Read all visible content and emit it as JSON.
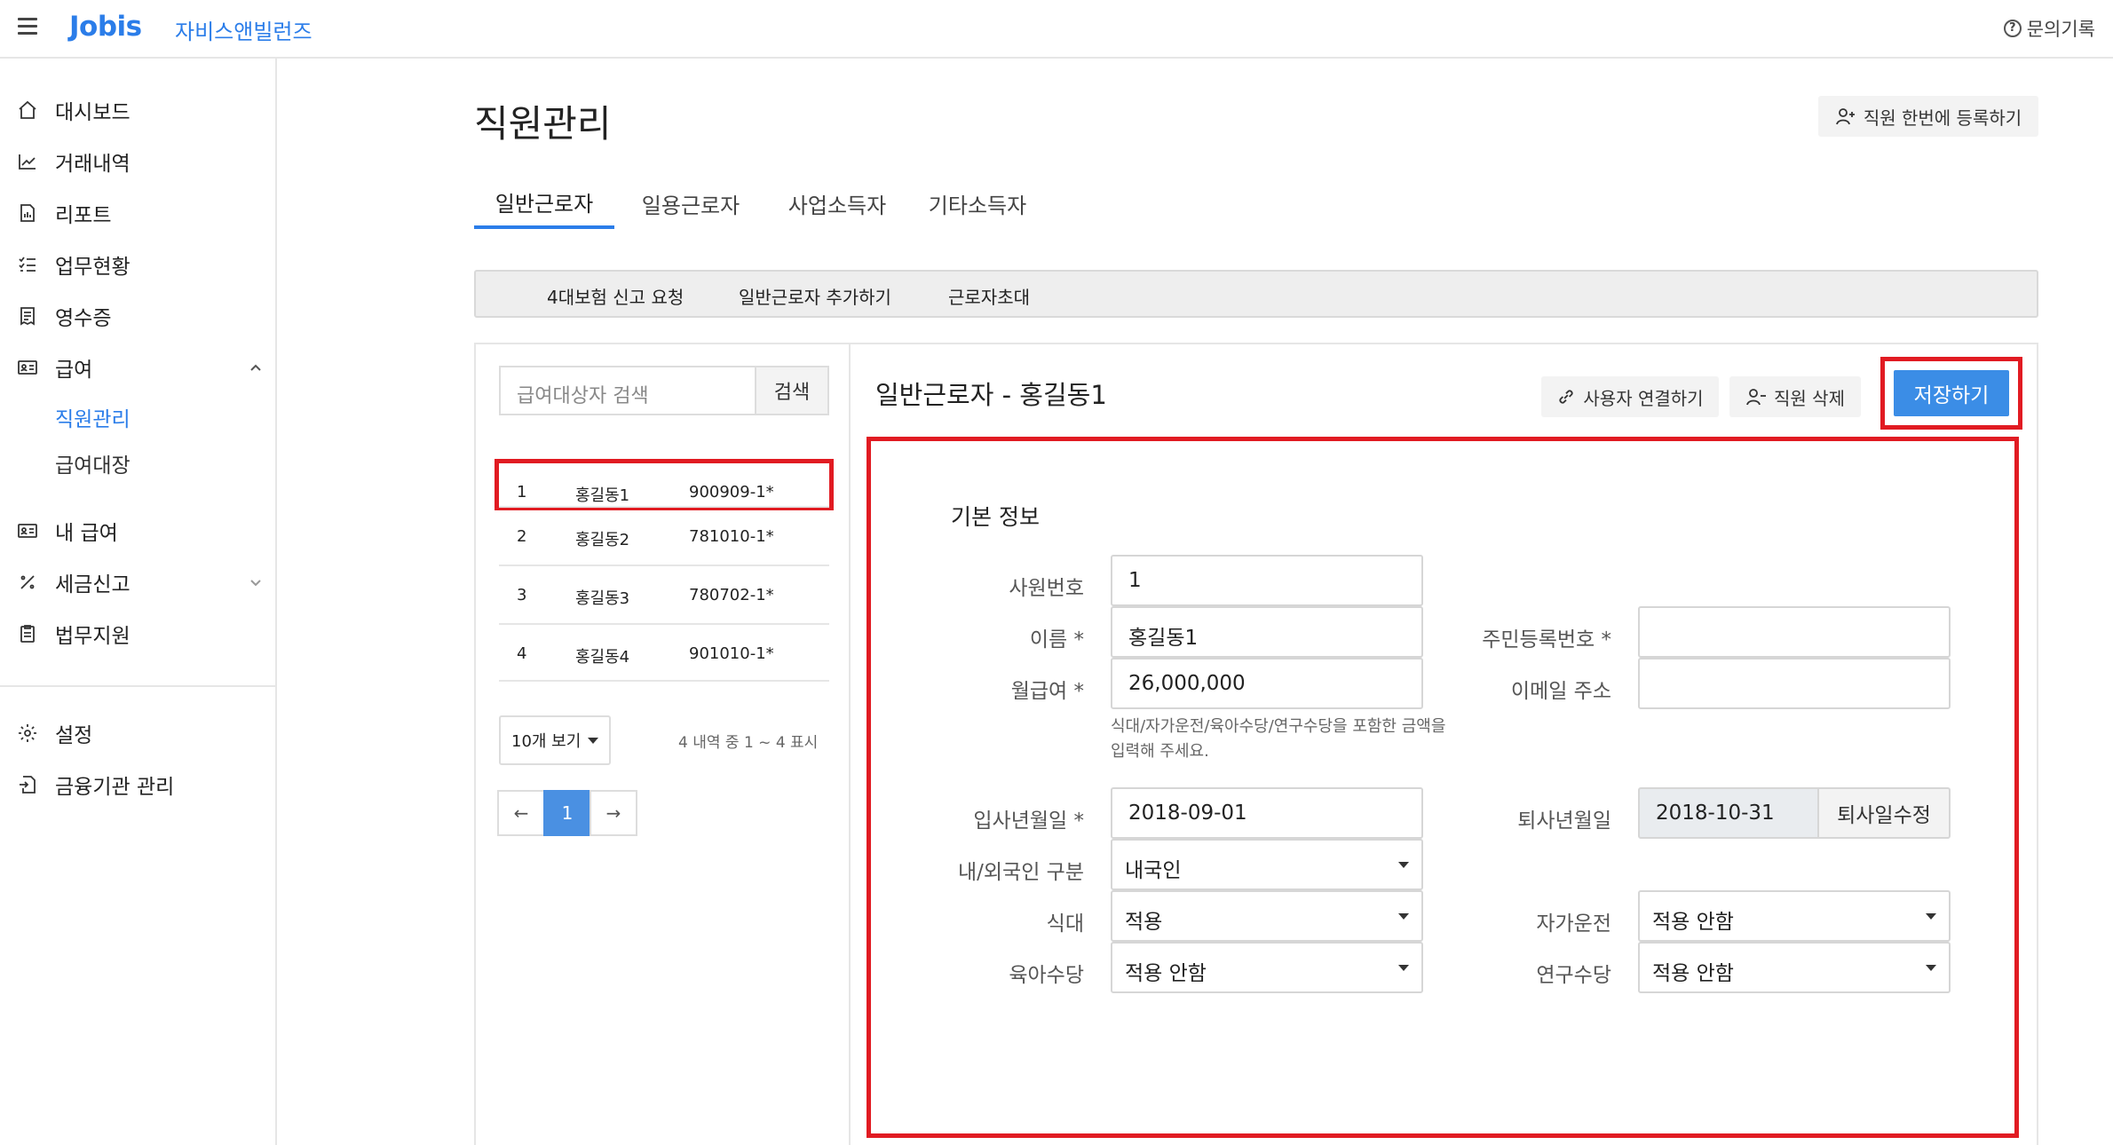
{
  "header": {
    "logo": "Jobis",
    "company": "자비스앤빌런즈",
    "inquiry": "문의기록"
  },
  "sidebar": {
    "items": [
      {
        "label": "대시보드",
        "icon": "home-icon"
      },
      {
        "label": "거래내역",
        "icon": "trend-icon"
      },
      {
        "label": "리포트",
        "icon": "report-icon"
      },
      {
        "label": "업무현황",
        "icon": "checklist-icon"
      },
      {
        "label": "영수증",
        "icon": "receipt-icon"
      },
      {
        "label": "급여",
        "icon": "id-card-icon"
      },
      {
        "label": "내 급여",
        "icon": "id-card-icon"
      },
      {
        "label": "세금신고",
        "icon": "percent-icon"
      },
      {
        "label": "법무지원",
        "icon": "clipboard-icon"
      },
      {
        "label": "설정",
        "icon": "gear-icon"
      },
      {
        "label": "금융기관 관리",
        "icon": "document-arrow-icon"
      }
    ],
    "sub_items": [
      "직원관리",
      "급여대장"
    ]
  },
  "page": {
    "title": "직원관리",
    "bulk_register": "직원 한번에 등록하기",
    "tabs": [
      "일반근로자",
      "일용근로자",
      "사업소득자",
      "기타소득자"
    ],
    "actions": [
      "4대보험 신고 요청",
      "일반근로자 추가하기",
      "근로자초대"
    ]
  },
  "list": {
    "search_placeholder": "급여대상자 검색",
    "search_button": "검색",
    "rows": [
      {
        "no": "1",
        "name": "홍길동1",
        "id": "900909-1*"
      },
      {
        "no": "2",
        "name": "홍길동2",
        "id": "781010-1*"
      },
      {
        "no": "3",
        "name": "홍길동3",
        "id": "780702-1*"
      },
      {
        "no": "4",
        "name": "홍길동4",
        "id": "901010-1*"
      }
    ],
    "page_size": "10개 보기",
    "count_info": "4 내역 중 1 ~ 4 표시",
    "pager": {
      "prev": "←",
      "current": "1",
      "next": "→"
    }
  },
  "detail": {
    "title": "일반근로자 - 홍길동1",
    "link_user": "사용자 연결하기",
    "delete_employee": "직원 삭제",
    "save": "저장하기",
    "section": "기본 정보",
    "fields": {
      "emp_no_label": "사원번호",
      "emp_no": "1",
      "name_label": "이름 *",
      "name": "홍길동1",
      "rrn_label": "주민등록번호 *",
      "rrn": "",
      "salary_label": "월급여 *",
      "salary": "26,000,000",
      "salary_help": "식대/자가운전/육아수당/연구수당을 포함한 금액을 입력해 주세요.",
      "email_label": "이메일 주소",
      "email": "",
      "join_label": "입사년월일 *",
      "join": "2018-09-01",
      "leave_label": "퇴사년월일",
      "leave": "2018-10-31",
      "leave_edit": "퇴사일수정",
      "nationality_label": "내/외국인 구분",
      "nationality": "내국인",
      "meal_label": "식대",
      "meal": "적용",
      "car_label": "자가운전",
      "car": "적용 안함",
      "child_label": "육아수당",
      "child": "적용 안함",
      "research_label": "연구수당",
      "research": "적용 안함"
    }
  }
}
